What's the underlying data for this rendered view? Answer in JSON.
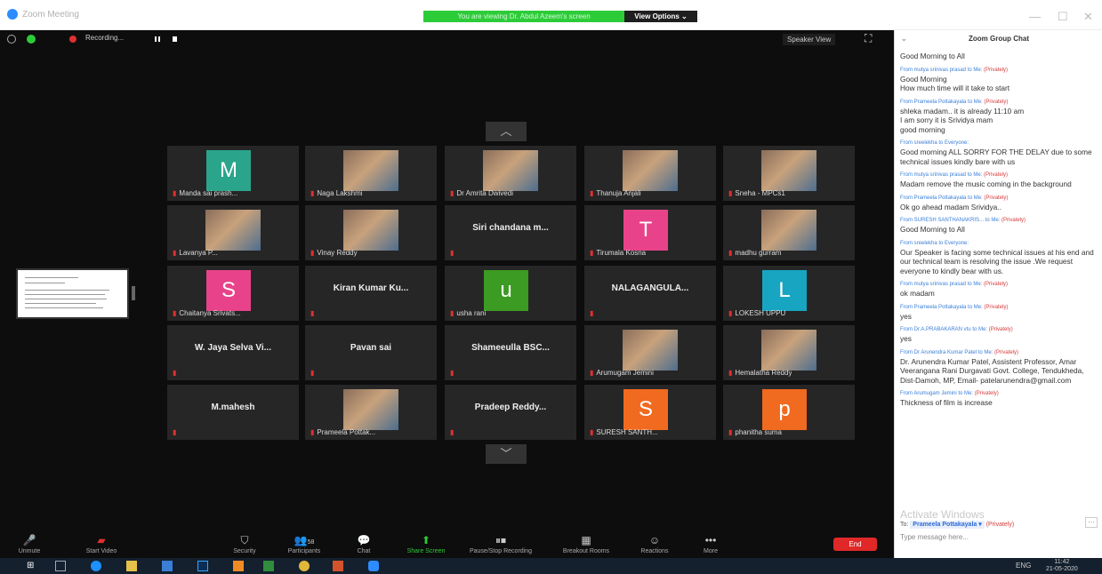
{
  "window": {
    "title": "Zoom Meeting",
    "viewing_banner": "You are viewing Dr. Abdul Azeem's screen",
    "view_options": "View Options ⌄"
  },
  "topbar": {
    "recording": "Recording...",
    "speaker_view": "Speaker View"
  },
  "grid": [
    [
      {
        "name": "Manda sai prash...",
        "avatar": "M",
        "color": "#2aa58c"
      },
      {
        "name": "Naga Lakshmi",
        "photo": true
      },
      {
        "name": "Dr Amrita Dwivedi",
        "photo": true
      },
      {
        "name": "Thanuja Anjali",
        "photo": true
      },
      {
        "name": "Sneha - MPCs1",
        "photo": true
      }
    ],
    [
      {
        "name": "Lavanya P...",
        "photo": true
      },
      {
        "name": "Vinay Reddy",
        "photo": true
      },
      {
        "name": "Siri chandana m...",
        "big": true
      },
      {
        "name": "Tirumala Kosna",
        "avatar": "T",
        "color": "#e8438a"
      },
      {
        "name": "madhu gurram",
        "photo": true
      }
    ],
    [
      {
        "name": "Chaitanya Srivats...",
        "avatar": "S",
        "color": "#e8438a"
      },
      {
        "name": "Kiran Kumar Ku...",
        "big": true
      },
      {
        "name": "usha rani",
        "avatar": "u",
        "color": "#3c9b22"
      },
      {
        "name": "NALAGANGULA...",
        "big": true
      },
      {
        "name": "LOKESH UPPU",
        "avatar": "L",
        "color": "#17a5c2"
      }
    ],
    [
      {
        "name": "W. Jaya Selva Vi...",
        "big": true
      },
      {
        "name": "Pavan sai",
        "big": true
      },
      {
        "name": "Shameeulla BSC...",
        "big": true
      },
      {
        "name": "Arumugam Jemini",
        "photo": true
      },
      {
        "name": "Hemalatha Reddy",
        "photo": true
      }
    ],
    [
      {
        "name": "M.mahesh",
        "big": true
      },
      {
        "name": "Prameela Pottak...",
        "photo": true
      },
      {
        "name": "Pradeep Reddy...",
        "big": true
      },
      {
        "name": "SURESH SANTH...",
        "avatar": "S",
        "color": "#f06a1f"
      },
      {
        "name": "phanitha suma",
        "avatar": "p",
        "color": "#f06a1f"
      }
    ]
  ],
  "toolbar": {
    "unmute": "Unmute",
    "start_video": "Start Video",
    "security": "Security",
    "participants": "Participants",
    "participants_count": "58",
    "chat": "Chat",
    "share_screen": "Share Screen",
    "pause_recording": "Pause/Stop Recording",
    "breakout": "Breakout Rooms",
    "reactions": "Reactions",
    "more": "More",
    "end": "End"
  },
  "chat": {
    "title": "Zoom Group Chat",
    "messages": [
      {
        "from": "",
        "private": "",
        "text": "Good Morning to All"
      },
      {
        "from": "From mutya srinivas prasad to Me:",
        "private": "(Privately)",
        "text": "Good Morning\nHow much time will it take to start"
      },
      {
        "from": "From Prameela Pottakayala to Me:",
        "private": "(Privately)",
        "text": "shleka madam.. it is already 11:10 am\nI am sorry it is Srividya mam\ngood morning"
      },
      {
        "from": "From sreelekha to Everyone:",
        "private": "",
        "text": "Good morning ALL SORRY FOR THE DELAY due to some technical issues kindly bare with us"
      },
      {
        "from": "From mutya srinivas prasad to Me:",
        "private": "(Privately)",
        "text": "Madam remove the music coming in the background"
      },
      {
        "from": "From Prameela Pottakayala to Me:",
        "private": "(Privately)",
        "text": "Ok go ahead madam Srividya.."
      },
      {
        "from": "From SURESH SANTHANAKRIS... to Me:",
        "private": "(Privately)",
        "text": "Good Morning to All"
      },
      {
        "from": "From sreelekha to Everyone:",
        "private": "",
        "text": "Our Speaker is facing some technical issues at his end and our technical team is resolving the issue .We request everyone to kindly bear with us."
      },
      {
        "from": "From mutya srinivas prasad to Me:",
        "private": "(Privately)",
        "text": "ok madam"
      },
      {
        "from": "From Prameela Pottakayala to Me:",
        "private": "(Privately)",
        "text": "yes"
      },
      {
        "from": "From Dr.A.PRABAKARAN vtu to Me:",
        "private": "(Privately)",
        "text": "yes"
      },
      {
        "from": "From Dr Arunendra Kumar Patel to Me:",
        "private": "(Privately)",
        "text": "Dr. Arunendra Kumar Patel, Assistent Professor, Amar Veerangana Rani Durgavati Govt. College, Tendukheda, Dist-Damoh, MP, Email- patelarunendra@gmail.com"
      },
      {
        "from": "From Arumugam Jemini to Me:",
        "private": "(Privately)",
        "text": "Thickness of film is increase"
      }
    ],
    "activate_windows": "Activate Windows",
    "to_label": "To:",
    "to_value": "Prameela Pottakayala ▾",
    "to_private": "(Privately)",
    "placeholder": "Type message here..."
  },
  "taskbar": {
    "lang": "ENG",
    "time": "11:42",
    "date": "21-05-2020"
  }
}
